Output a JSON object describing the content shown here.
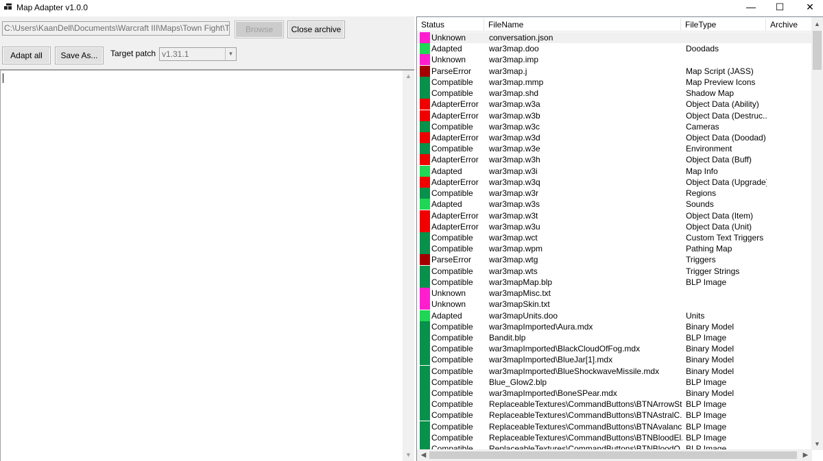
{
  "window": {
    "title": "Map Adapter v1.0.0",
    "icon": "app-window-icon",
    "minimize_glyph": "—",
    "maximize_glyph": "☐",
    "close_glyph": "✕"
  },
  "toolbar": {
    "archive_path": "C:\\Users\\KaanDell\\Documents\\Warcraft III\\Maps\\Town Fight\\Town",
    "browse_label": "Browse",
    "close_archive_label": "Close archive",
    "adapt_all_label": "Adapt all",
    "save_as_label": "Save As...",
    "target_patch_label": "Target patch",
    "target_patch_value": "v1.31.1"
  },
  "list": {
    "columns": [
      "Status",
      "FileName",
      "FileType",
      "Archive"
    ],
    "status_colors": {
      "Unknown": "#ff1dce",
      "Adapted": "#1fd655",
      "ParseError": "#a40000",
      "Compatible": "#08914a",
      "AdapterError": "#f00000"
    },
    "rows": [
      {
        "status": "Unknown",
        "file": "conversation.json",
        "type": ""
      },
      {
        "status": "Adapted",
        "file": "war3map.doo",
        "type": "Doodads"
      },
      {
        "status": "Unknown",
        "file": "war3map.imp",
        "type": ""
      },
      {
        "status": "ParseError",
        "file": "war3map.j",
        "type": "Map Script (JASS)"
      },
      {
        "status": "Compatible",
        "file": "war3map.mmp",
        "type": "Map Preview Icons"
      },
      {
        "status": "Compatible",
        "file": "war3map.shd",
        "type": "Shadow Map"
      },
      {
        "status": "AdapterError",
        "file": "war3map.w3a",
        "type": "Object Data (Ability)"
      },
      {
        "status": "AdapterError",
        "file": "war3map.w3b",
        "type": "Object Data (Destruc..."
      },
      {
        "status": "Compatible",
        "file": "war3map.w3c",
        "type": "Cameras"
      },
      {
        "status": "AdapterError",
        "file": "war3map.w3d",
        "type": "Object Data (Doodad)"
      },
      {
        "status": "Compatible",
        "file": "war3map.w3e",
        "type": "Environment"
      },
      {
        "status": "AdapterError",
        "file": "war3map.w3h",
        "type": "Object Data (Buff)"
      },
      {
        "status": "Adapted",
        "file": "war3map.w3i",
        "type": "Map Info"
      },
      {
        "status": "AdapterError",
        "file": "war3map.w3q",
        "type": "Object Data (Upgrade)"
      },
      {
        "status": "Compatible",
        "file": "war3map.w3r",
        "type": "Regions"
      },
      {
        "status": "Adapted",
        "file": "war3map.w3s",
        "type": "Sounds"
      },
      {
        "status": "AdapterError",
        "file": "war3map.w3t",
        "type": "Object Data (Item)"
      },
      {
        "status": "AdapterError",
        "file": "war3map.w3u",
        "type": "Object Data (Unit)"
      },
      {
        "status": "Compatible",
        "file": "war3map.wct",
        "type": "Custom Text Triggers"
      },
      {
        "status": "Compatible",
        "file": "war3map.wpm",
        "type": "Pathing Map"
      },
      {
        "status": "ParseError",
        "file": "war3map.wtg",
        "type": "Triggers"
      },
      {
        "status": "Compatible",
        "file": "war3map.wts",
        "type": "Trigger Strings"
      },
      {
        "status": "Compatible",
        "file": "war3mapMap.blp",
        "type": "BLP Image"
      },
      {
        "status": "Unknown",
        "file": "war3mapMisc.txt",
        "type": ""
      },
      {
        "status": "Unknown",
        "file": "war3mapSkin.txt",
        "type": ""
      },
      {
        "status": "Adapted",
        "file": "war3mapUnits.doo",
        "type": "Units"
      },
      {
        "status": "Compatible",
        "file": "war3mapImported\\Aura.mdx",
        "type": "Binary Model"
      },
      {
        "status": "Compatible",
        "file": "Bandit.blp",
        "type": "BLP Image"
      },
      {
        "status": "Compatible",
        "file": "war3mapImported\\BlackCloudOfFog.mdx",
        "type": "Binary Model"
      },
      {
        "status": "Compatible",
        "file": "war3mapImported\\BlueJar[1].mdx",
        "type": "Binary Model"
      },
      {
        "status": "Compatible",
        "file": "war3mapImported\\BlueShockwaveMissile.mdx",
        "type": "Binary Model"
      },
      {
        "status": "Compatible",
        "file": "Blue_Glow2.blp",
        "type": "BLP Image"
      },
      {
        "status": "Compatible",
        "file": "war3mapImported\\BoneSPear.mdx",
        "type": "Binary Model"
      },
      {
        "status": "Compatible",
        "file": "ReplaceableTextures\\CommandButtons\\BTNArrowSt...",
        "type": "BLP Image"
      },
      {
        "status": "Compatible",
        "file": "ReplaceableTextures\\CommandButtons\\BTNAstralC...",
        "type": "BLP Image"
      },
      {
        "status": "Compatible",
        "file": "ReplaceableTextures\\CommandButtons\\BTNAvalanc...",
        "type": "BLP Image"
      },
      {
        "status": "Compatible",
        "file": "ReplaceableTextures\\CommandButtons\\BTNBloodEl...",
        "type": "BLP Image"
      },
      {
        "status": "Compatible",
        "file": "ReplaceableTextures\\CommandButtons\\BTNBloodO...",
        "type": "BLP Image"
      }
    ]
  }
}
